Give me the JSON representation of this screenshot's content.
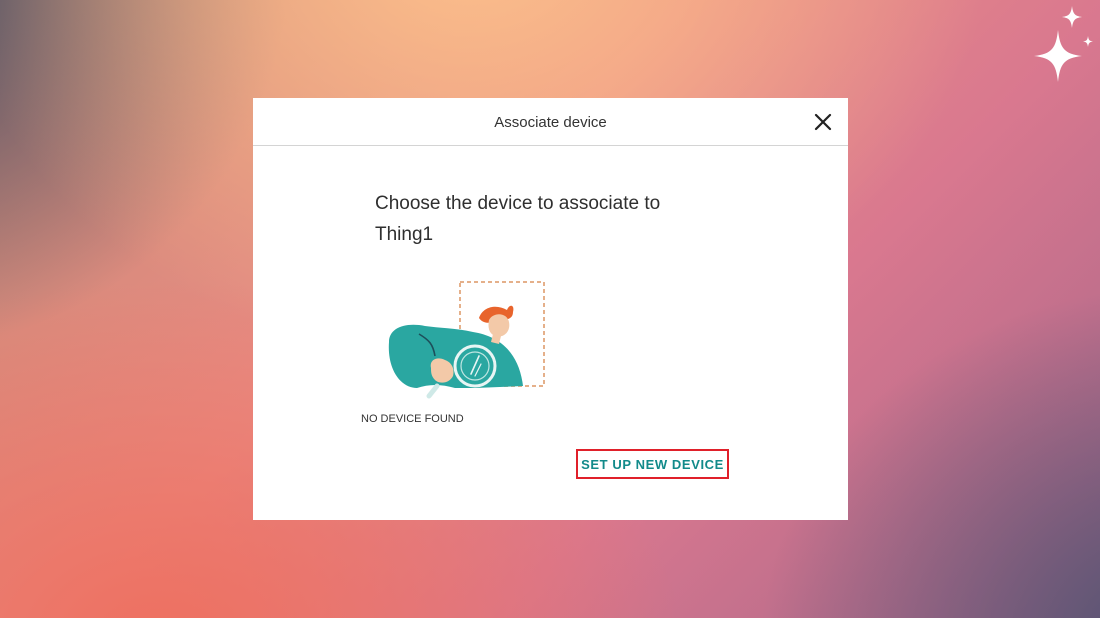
{
  "dialog": {
    "title": "Associate device",
    "close_icon": "close-icon",
    "prompt": "Choose the device to associate to Thing1",
    "illustration": "person-with-magnifying-glass-illustration",
    "empty_state": "NO DEVICE FOUND",
    "setup_button_label": "SET UP NEW DEVICE"
  },
  "colors": {
    "accent_teal": "#128a8a",
    "highlight_red": "#e0202a",
    "illustration_teal": "#2aa7a1",
    "illustration_orange": "#e8642c"
  }
}
